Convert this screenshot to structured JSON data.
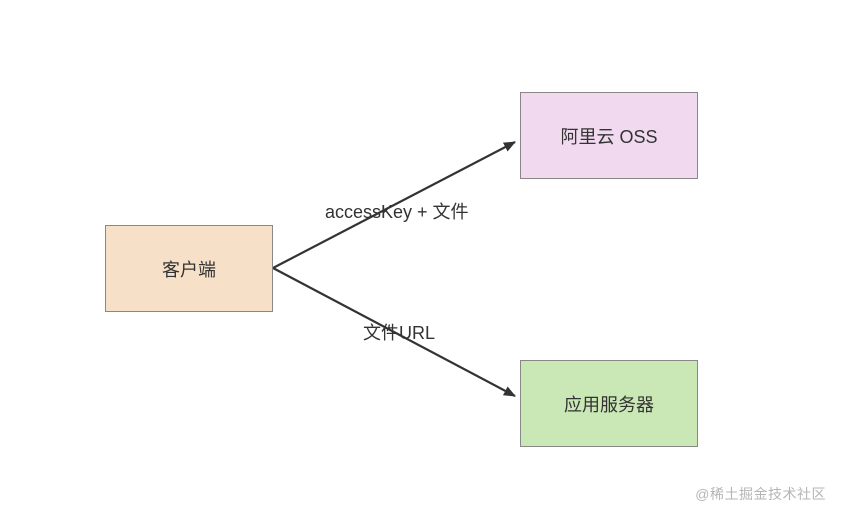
{
  "nodes": {
    "client": {
      "label": "客户端",
      "fill": "#f6e0c8"
    },
    "oss": {
      "label": "阿里云 OSS",
      "fill": "#f1daf0"
    },
    "server": {
      "label": "应用服务器",
      "fill": "#cae8b5"
    }
  },
  "edges": {
    "client_to_oss": {
      "label": "accessKey + 文件"
    },
    "client_to_server": {
      "label": "文件URL"
    }
  },
  "watermark": "@稀土掘金技术社区"
}
